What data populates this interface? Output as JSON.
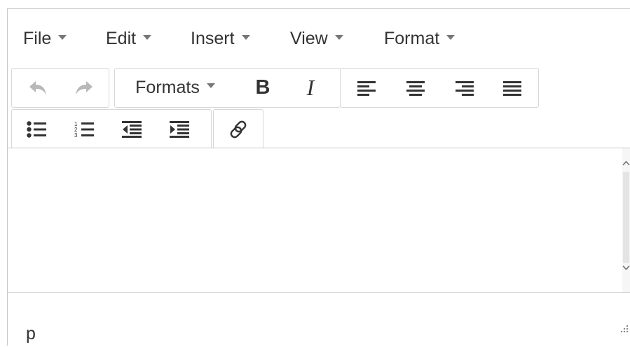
{
  "menubar": {
    "items": [
      {
        "label": "File"
      },
      {
        "label": "Edit"
      },
      {
        "label": "Insert"
      },
      {
        "label": "View"
      },
      {
        "label": "Format"
      }
    ]
  },
  "toolbar": {
    "formats_label": "Formats",
    "bold_label": "B",
    "italic_label": "I",
    "icons": [
      "undo-icon",
      "redo-icon",
      "align-left-icon",
      "align-center-icon",
      "align-right-icon",
      "align-justify-icon",
      "bullet-list-icon",
      "numbered-list-icon",
      "outdent-icon",
      "indent-icon",
      "link-icon"
    ]
  },
  "content": {
    "text": ""
  },
  "statusbar": {
    "path": "p"
  }
}
